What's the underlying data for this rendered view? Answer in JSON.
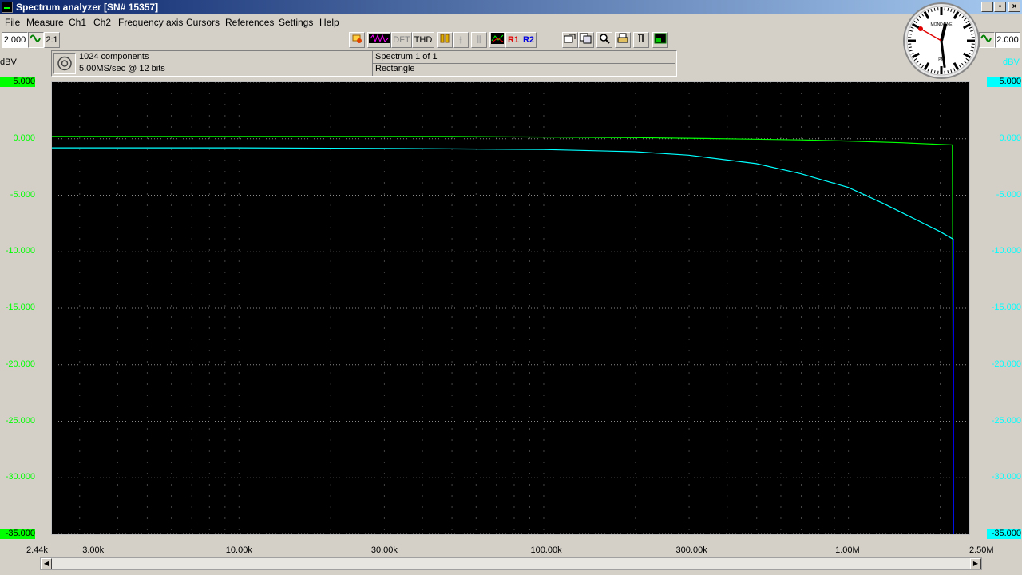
{
  "window": {
    "title": "Spectrum analyzer  [SN# 15357]"
  },
  "menu": [
    "File",
    "Measure",
    "Ch1",
    "Ch2",
    "Frequency axis",
    "Cursors",
    "References",
    "Settings",
    "Help"
  ],
  "toolbar": {
    "ch1_scale": "2.000",
    "ch2_scale": "2.000",
    "dft_label": "DFT",
    "thd_label": "THD",
    "r1_label": "R1",
    "r2_label": "R2",
    "ratio_label": "2:1"
  },
  "info": {
    "components": "1024 components",
    "rate": "5.00MS/sec @ 12 bits",
    "spectrum": "Spectrum 1 of 1",
    "window_fn": "Rectangle"
  },
  "clock": {
    "brand": "MONDAINE",
    "ampm": "PM",
    "hour": 12,
    "minute": 28,
    "second": 50
  },
  "colors": {
    "ch1": "#00ff00",
    "ch2": "#00ffff",
    "ch2_tail": "#0000ff"
  },
  "chart_data": {
    "type": "line",
    "x_scale": "log",
    "xlim": [
      2440,
      2500000
    ],
    "ylim": [
      -35,
      5
    ],
    "left_unit": "dBV",
    "right_unit": "dBV",
    "left_ticks": [
      "5.000",
      "0.000",
      "-5.000",
      "-10.000",
      "-15.000",
      "-20.000",
      "-25.000",
      "-30.000",
      "-35.000"
    ],
    "right_ticks": [
      "5.000",
      "0.000",
      "-5.000",
      "-10.000",
      "-15.000",
      "-20.000",
      "-25.000",
      "-30.000",
      "-35.000"
    ],
    "y_tick_values": [
      5,
      0,
      -5,
      -10,
      -15,
      -20,
      -25,
      -30,
      -35
    ],
    "x_ticks": [
      {
        "label": "2.44k",
        "value": 2440
      },
      {
        "label": "3.00k",
        "value": 3000
      },
      {
        "label": "10.00k",
        "value": 10000
      },
      {
        "label": "30.00k",
        "value": 30000
      },
      {
        "label": "100.00k",
        "value": 100000
      },
      {
        "label": "300.00k",
        "value": 300000
      },
      {
        "label": "1.00M",
        "value": 1000000
      },
      {
        "label": "2.50M",
        "value": 2500000
      }
    ],
    "series": [
      {
        "color": "#00ff00",
        "points": [
          [
            2440,
            0.2
          ],
          [
            10000,
            0.2
          ],
          [
            50000,
            0.2
          ],
          [
            100000,
            0.15
          ],
          [
            200000,
            0.1
          ],
          [
            400000,
            0.0
          ],
          [
            700000,
            -0.1
          ],
          [
            1000000,
            -0.2
          ],
          [
            1500000,
            -0.35
          ],
          [
            2200000,
            -0.55
          ],
          [
            2220000,
            -35
          ]
        ]
      },
      {
        "color": "#00ffff",
        "points": [
          [
            2440,
            -0.8
          ],
          [
            10000,
            -0.8
          ],
          [
            30000,
            -0.85
          ],
          [
            100000,
            -0.95
          ],
          [
            200000,
            -1.15
          ],
          [
            300000,
            -1.45
          ],
          [
            500000,
            -2.2
          ],
          [
            700000,
            -3.1
          ],
          [
            1000000,
            -4.3
          ],
          [
            1300000,
            -5.7
          ],
          [
            1600000,
            -6.9
          ],
          [
            2000000,
            -8.2
          ],
          [
            2220000,
            -8.9
          ]
        ]
      },
      {
        "color": "#0000ff",
        "points": [
          [
            2220000,
            -8.9
          ],
          [
            2220000,
            -35
          ]
        ]
      }
    ]
  }
}
